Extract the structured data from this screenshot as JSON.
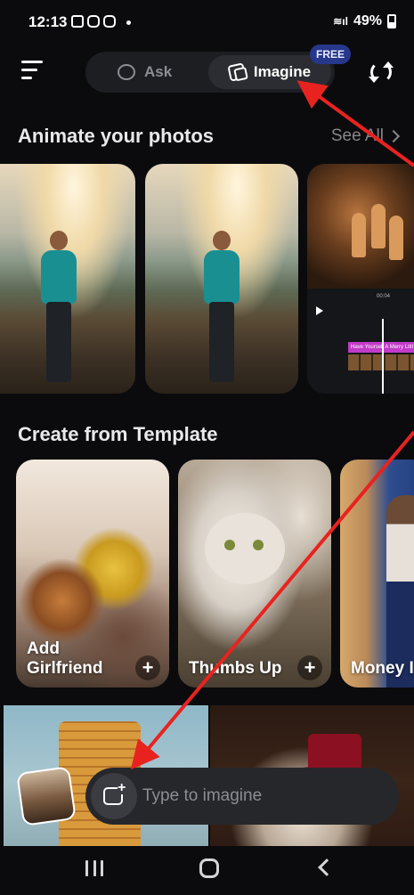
{
  "status": {
    "time": "12:13",
    "battery": "49%"
  },
  "nav": {
    "ask_label": "Ask",
    "imagine_label": "Imagine",
    "badge": "FREE"
  },
  "sections": {
    "animate": {
      "title": "Animate your photos",
      "see_all": "See All"
    },
    "templates": {
      "title": "Create from Template"
    }
  },
  "video": {
    "caption": "Have Yourself A Merry Littl",
    "time": "00:04"
  },
  "templates": [
    {
      "label": "Add Girlfriend"
    },
    {
      "label": "Thumbs Up"
    },
    {
      "label": "Money I"
    }
  ],
  "composer": {
    "placeholder": "Type to imagine"
  },
  "colors": {
    "accent_badge": "#27378c",
    "annotation_arrow": "#e8231f",
    "background": "#0b0b0d"
  }
}
